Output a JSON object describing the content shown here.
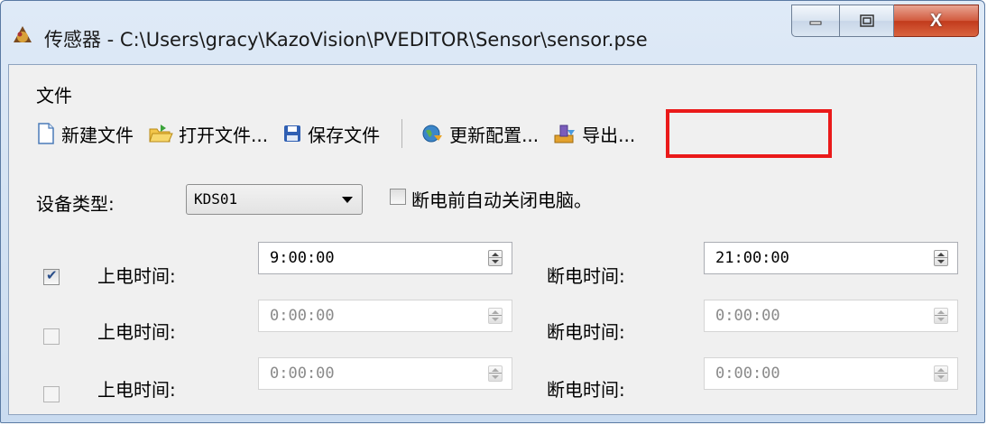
{
  "window": {
    "title": "传感器 - C:\\Users\\gracy\\KazoVision\\PVEDITOR\\Sensor\\sensor.pse",
    "close_glyph": "X"
  },
  "menu": {
    "file": "文件"
  },
  "toolbar": {
    "new_file": "新建文件",
    "open_file": "打开文件...",
    "save_file": "保存文件",
    "update_config": "更新配置...",
    "export": "导出..."
  },
  "device": {
    "type_label": "设备类型:",
    "type_value": "KDS01",
    "auto_shutdown_label": "断电前自动关闭电脑。",
    "auto_shutdown_checked": false
  },
  "schedule": {
    "power_on_label": "上电时间:",
    "power_off_label": "断电时间:",
    "rows": [
      {
        "enabled": true,
        "on_time": "9:00:00",
        "off_time": "21:00:00"
      },
      {
        "enabled": false,
        "on_time": "0:00:00",
        "off_time": "0:00:00"
      },
      {
        "enabled": false,
        "on_time": "0:00:00",
        "off_time": "0:00:00"
      }
    ]
  },
  "colors": {
    "highlight": "#ea1a1a",
    "title_bar": "#c9dbf0",
    "close_button": "#c23a1c"
  }
}
